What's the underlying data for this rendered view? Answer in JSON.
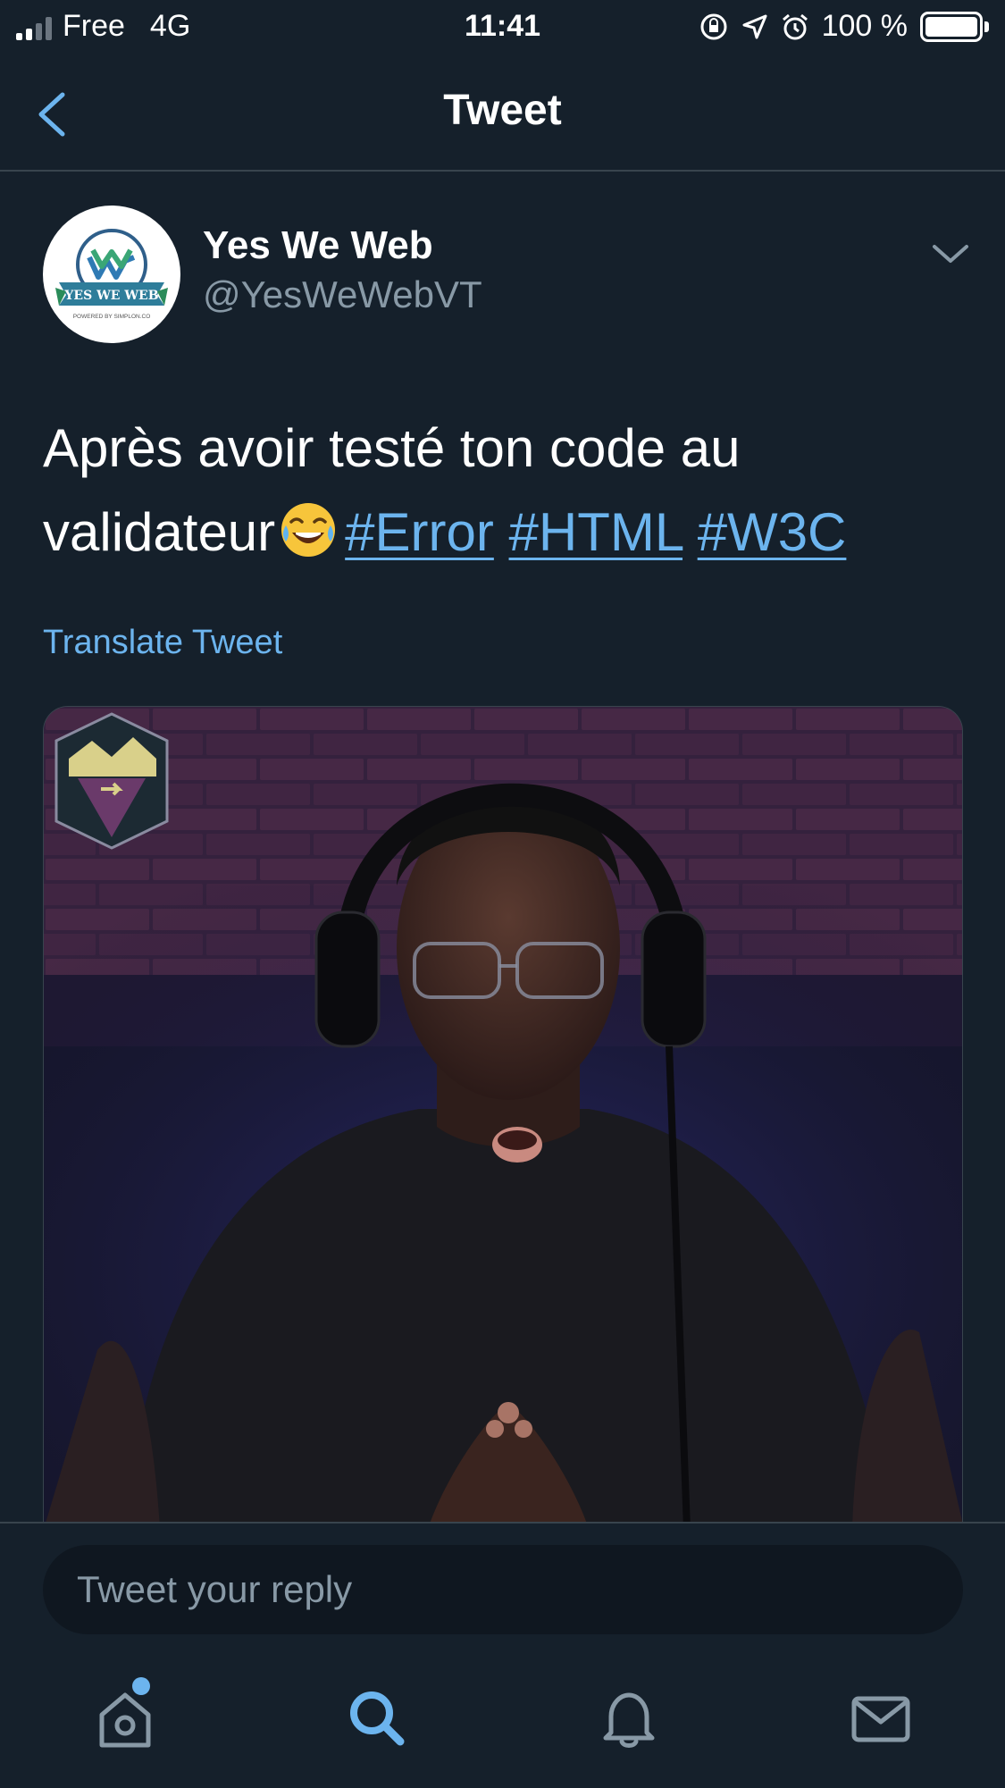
{
  "status_bar": {
    "carrier": "Free",
    "network": "4G",
    "time": "11:41",
    "battery": "100 %"
  },
  "header": {
    "title": "Tweet"
  },
  "tweet": {
    "author_name": "Yes We Web",
    "author_handle": "@YesWeWebVT",
    "avatar_text": "YES WE WEB",
    "avatar_subtext": "POWERED BY SIMPLON.CO",
    "text_line1": "Après avoir testé ton code au",
    "text_line2": "validateur",
    "emoji": "😂",
    "hashtags": [
      "#Error",
      "#HTML",
      "#W3C"
    ],
    "translate_label": "Translate Tweet"
  },
  "reply": {
    "placeholder": "Tweet your reply"
  },
  "tab_bar": {
    "items": [
      "home",
      "search",
      "notifications",
      "messages"
    ],
    "active": "search"
  },
  "colors": {
    "background": "#15202b",
    "accent": "#6cb4ee",
    "secondary_text": "#8899a6",
    "divider": "#38444d"
  }
}
